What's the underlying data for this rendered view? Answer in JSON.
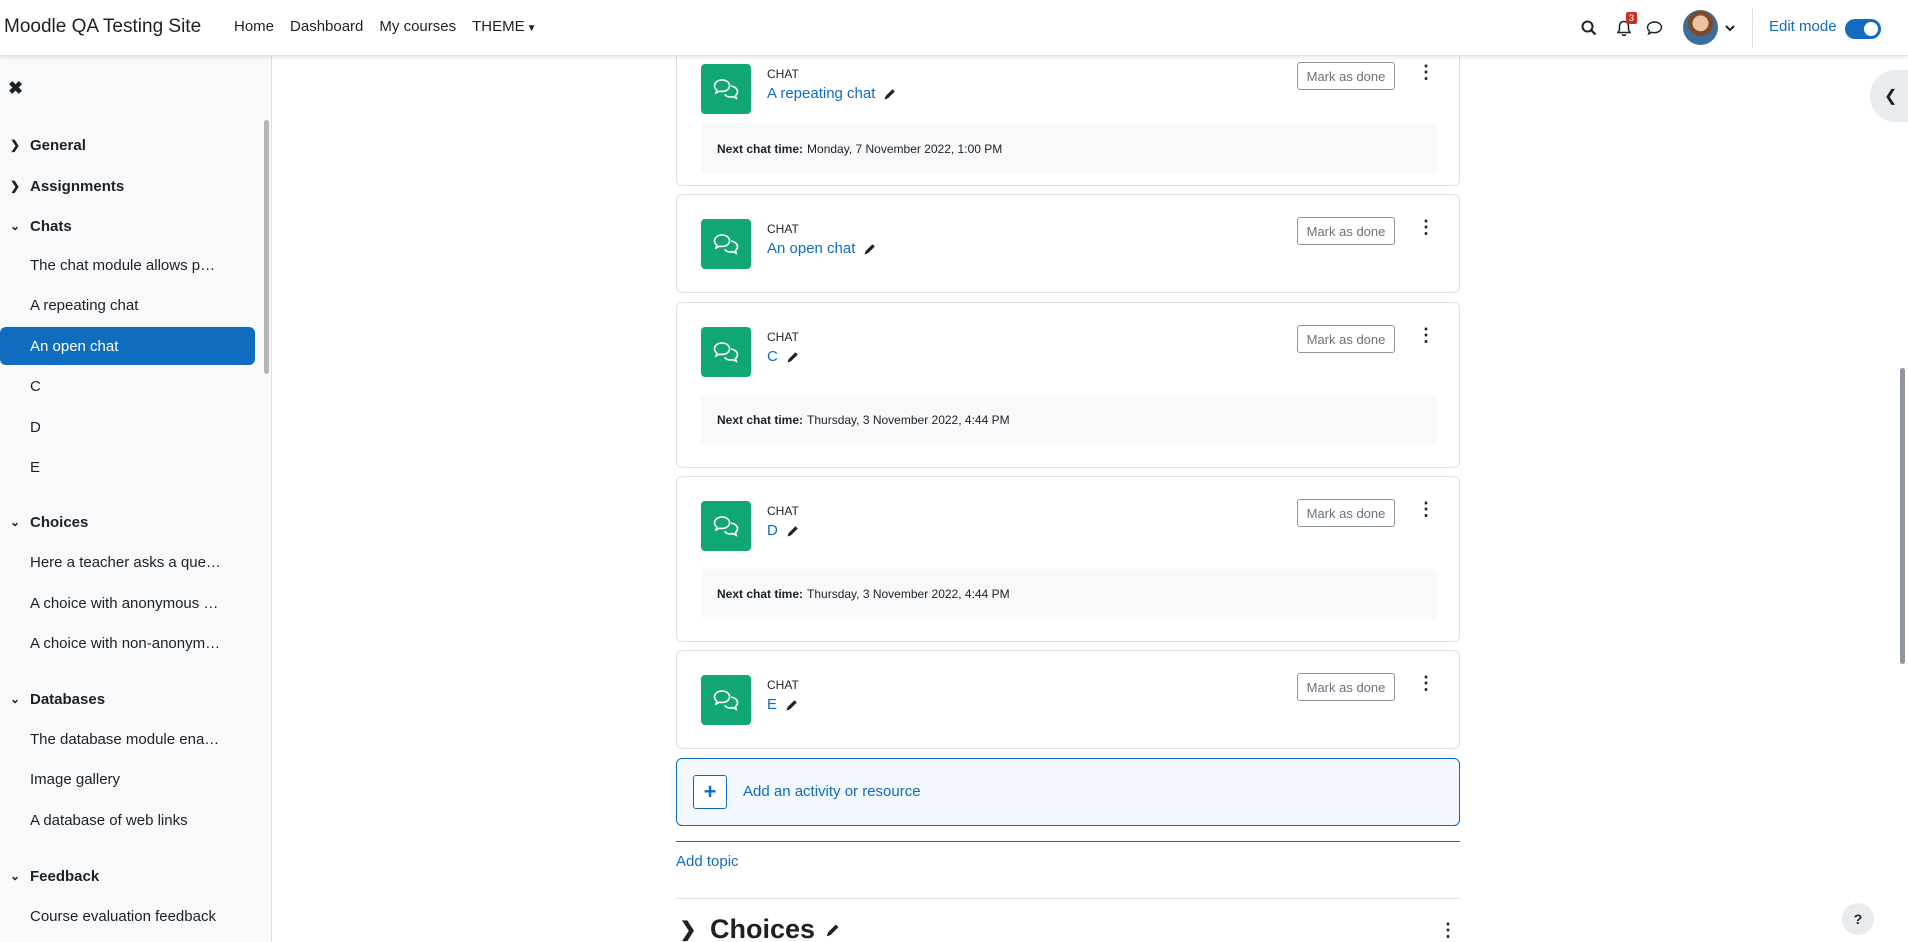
{
  "navbar": {
    "site_name": "Moodle QA Testing Site",
    "links": [
      "Home",
      "Dashboard",
      "My courses",
      "THEME"
    ],
    "notification_count": "3",
    "edit_mode_label": "Edit mode",
    "edit_mode_on": true,
    "icons": [
      "search-icon",
      "bell-icon",
      "chat-bubble-icon",
      "avatar",
      "chevron-down-icon"
    ]
  },
  "sidebar": {
    "sections": [
      {
        "title": "General",
        "expanded": false
      },
      {
        "title": "Assignments",
        "expanded": false
      },
      {
        "title": "Chats",
        "expanded": true,
        "items": [
          "The chat module allows p…",
          "A repeating chat",
          "An open chat",
          "C",
          "D",
          "E"
        ]
      },
      {
        "title": "Choices",
        "expanded": true,
        "items": [
          "Here a teacher asks a que…",
          "A choice with anonymous …",
          "A choice with non-anonym…"
        ]
      },
      {
        "title": "Databases",
        "expanded": true,
        "items": [
          "The database module ena…",
          "Image gallery",
          "A database of web links"
        ]
      },
      {
        "title": "Feedback",
        "expanded": true,
        "items": [
          "Course evaluation feedback"
        ]
      }
    ],
    "active_item": "An open chat"
  },
  "activities": [
    {
      "type": "CHAT",
      "name": "A repeating chat",
      "mark_label": "Mark as done",
      "info_label": "Next chat time:",
      "info_value": "Monday, 7 November 2022, 1:00 PM"
    },
    {
      "type": "CHAT",
      "name": "An open chat",
      "mark_label": "Mark as done"
    },
    {
      "type": "CHAT",
      "name": "C",
      "mark_label": "Mark as done",
      "info_label": "Next chat time:",
      "info_value": "Thursday, 3 November 2022, 4:44 PM"
    },
    {
      "type": "CHAT",
      "name": "D",
      "mark_label": "Mark as done",
      "info_label": "Next chat time:",
      "info_value": "Thursday, 3 November 2022, 4:44 PM"
    },
    {
      "type": "CHAT",
      "name": "E",
      "mark_label": "Mark as done"
    }
  ],
  "add_activity_label": "Add an activity or resource",
  "add_topic_label": "Add topic",
  "next_section_title": "Choices",
  "help_label": "?"
}
